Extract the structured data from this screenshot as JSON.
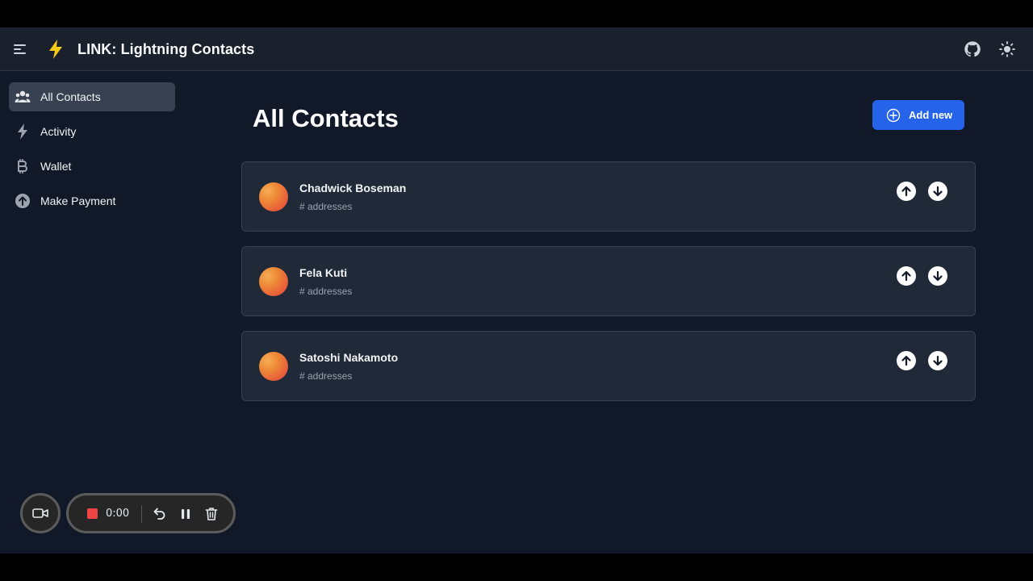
{
  "header": {
    "title": "LINK: Lightning Contacts",
    "menu_icon": "menu-icon",
    "logo_icon": "lightning-bolt-icon",
    "github_icon": "github-icon",
    "theme_icon": "sun-icon"
  },
  "sidebar": {
    "items": [
      {
        "label": "All Contacts",
        "icon": "users-icon",
        "active": true
      },
      {
        "label": "Activity",
        "icon": "lightning-icon",
        "active": false
      },
      {
        "label": "Wallet",
        "icon": "bitcoin-icon",
        "active": false
      },
      {
        "label": "Make Payment",
        "icon": "arrow-up-circle-icon",
        "active": false
      }
    ]
  },
  "main": {
    "title": "All Contacts",
    "add_button_label": "Add new",
    "contacts": [
      {
        "name": "Chadwick Boseman",
        "subtitle": "# addresses"
      },
      {
        "name": "Fela Kuti",
        "subtitle": "# addresses"
      },
      {
        "name": "Satoshi Nakamoto",
        "subtitle": "# addresses"
      }
    ]
  },
  "recorder": {
    "time": "0:00",
    "camera_icon": "video-camera-icon",
    "stop_icon": "stop-icon",
    "undo_icon": "undo-icon",
    "pause_icon": "pause-icon",
    "trash_icon": "trash-icon"
  },
  "colors": {
    "background": "#111827",
    "header": "#1a202c",
    "card": "#1f2937",
    "accent": "#2563eb",
    "logo": "#facc15",
    "record": "#ef4444"
  }
}
